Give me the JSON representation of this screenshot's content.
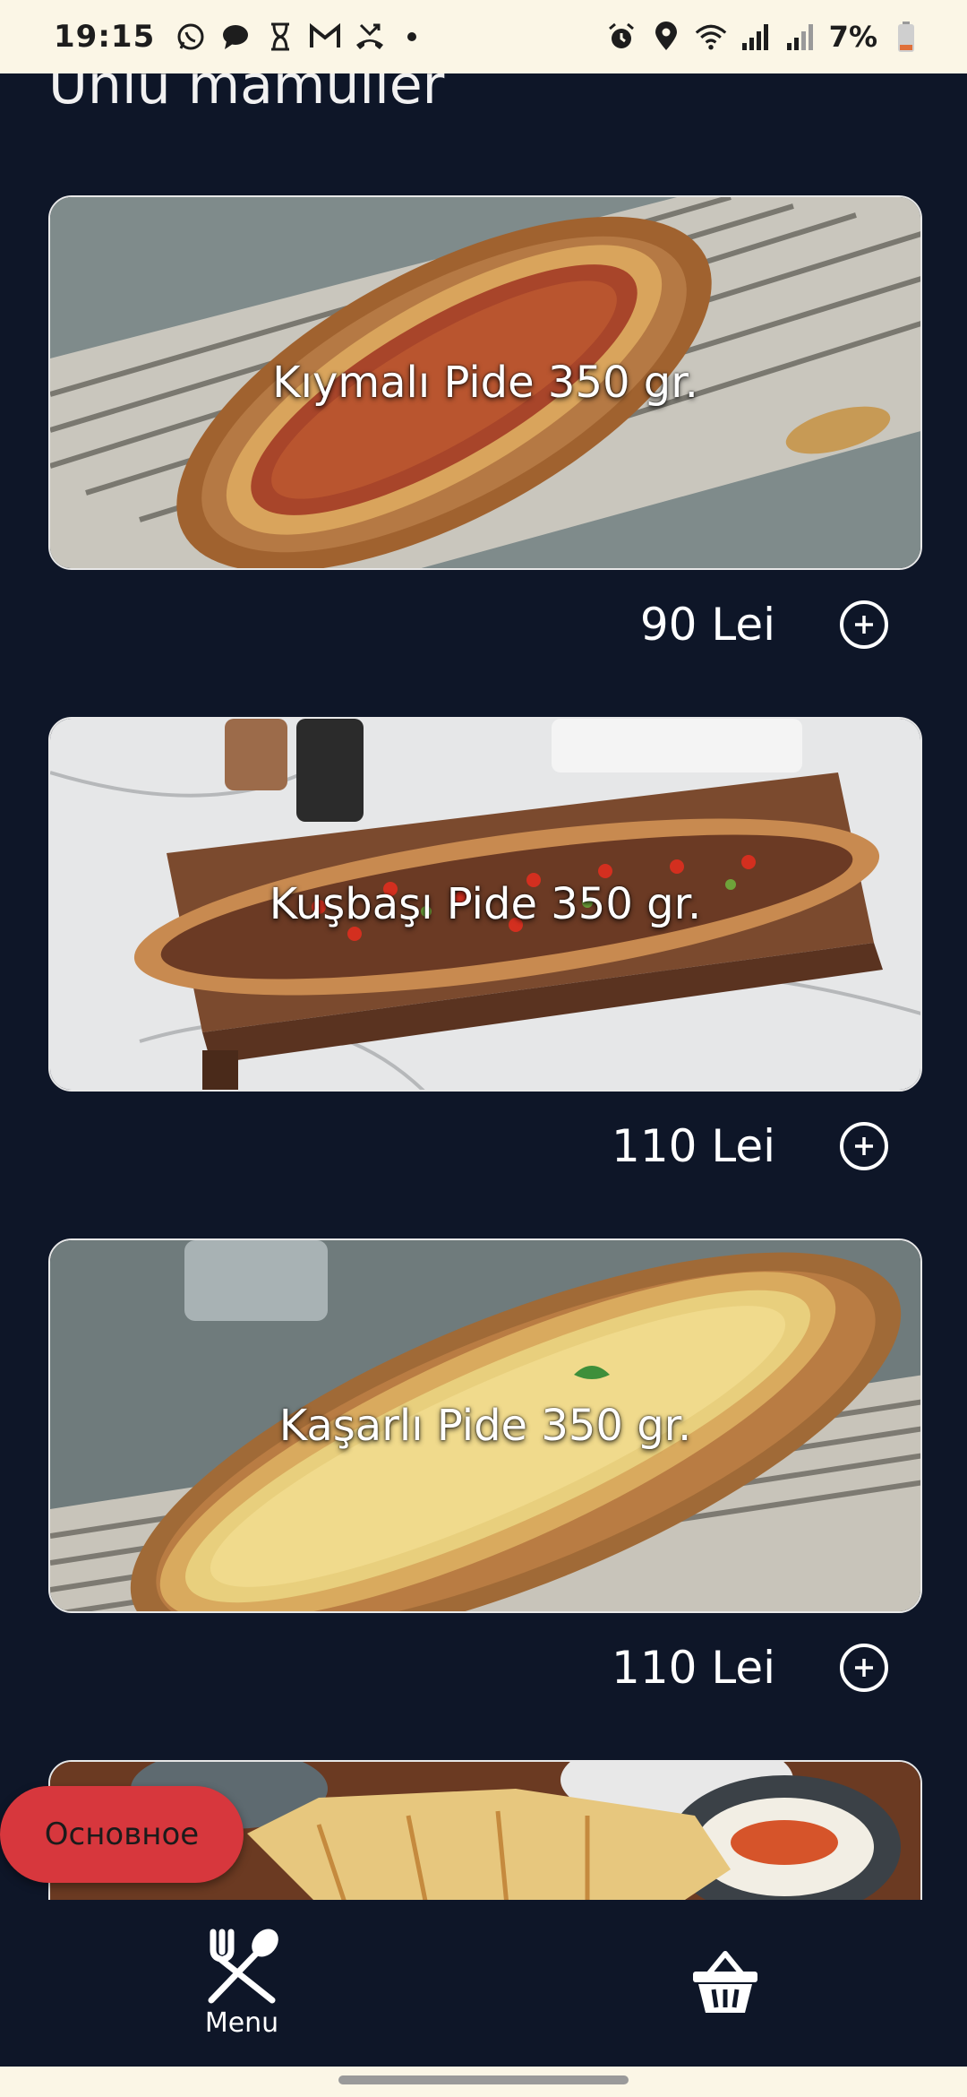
{
  "status_bar": {
    "time": "19:15",
    "battery": "7%",
    "left_icons": [
      "whatsapp-icon",
      "chat-icon",
      "hourglass-icon",
      "gmail-icon",
      "missed-call-icon"
    ],
    "right_icons": [
      "alarm-icon",
      "location-icon",
      "wifi-icon",
      "signal-icon",
      "signal-icon",
      "battery-icon"
    ]
  },
  "section": {
    "title": "Unlu mamüller"
  },
  "items": [
    {
      "name": "Kıymalı Pide 350 gr.",
      "price": "90 Lei"
    },
    {
      "name": "Kuşbaşı Pide 350 gr.",
      "price": "110 Lei"
    },
    {
      "name": "Kaşarlı Pide 350 gr.",
      "price": "110 Lei"
    },
    {
      "name": "",
      "price": ""
    }
  ],
  "category_chip": {
    "label": "Основное"
  },
  "bottom_nav": {
    "menu_label": "Menu",
    "menu_icon": "fork-spoon-icon",
    "cart_icon": "basket-icon"
  },
  "colors": {
    "background": "#0e1628",
    "accent": "#d7373d",
    "status_bar": "#fbf6e6"
  }
}
